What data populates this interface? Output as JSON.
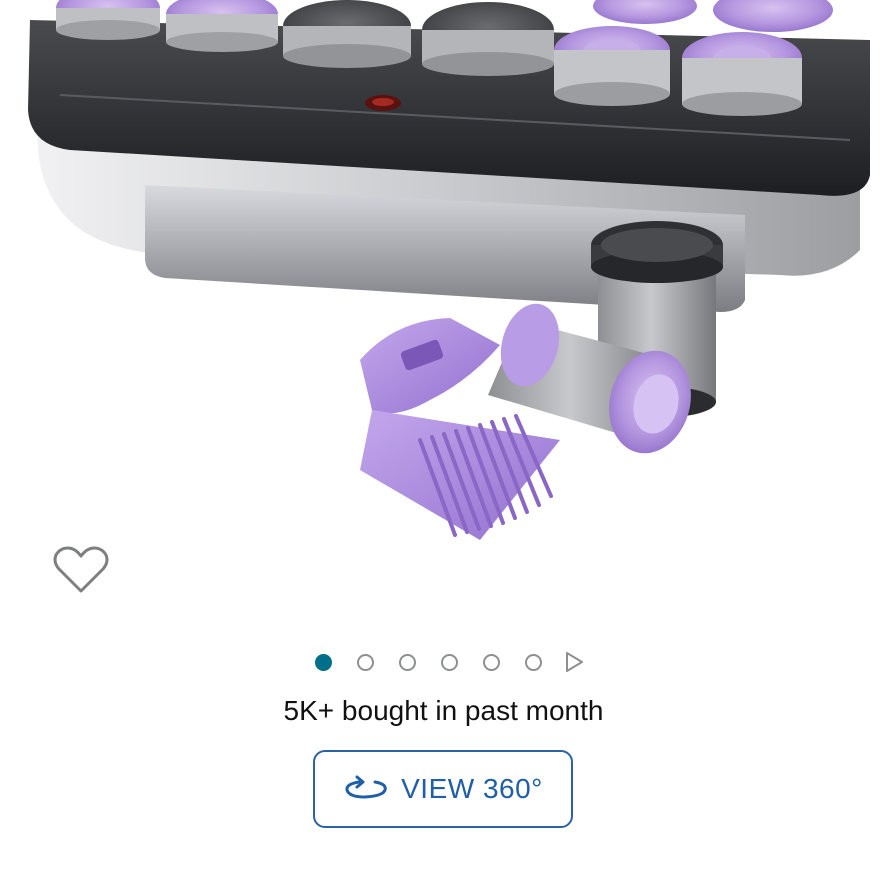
{
  "product_image": {
    "alt": "Hot rollers set with heating tray, roller and clip"
  },
  "favorite": {
    "icon": "heart-outline-icon",
    "state": "not-saved"
  },
  "carousel": {
    "total_images": 6,
    "current_index": 1,
    "active_color": "#00708a",
    "inactive_color": "#8e9090",
    "next_icon": "play-triangle-icon"
  },
  "social_proof": {
    "text": "5K+ bought in past month"
  },
  "view360_button": {
    "label": "VIEW 360°",
    "icon": "rotate-360-icon",
    "accent": "#1f5ea8"
  }
}
